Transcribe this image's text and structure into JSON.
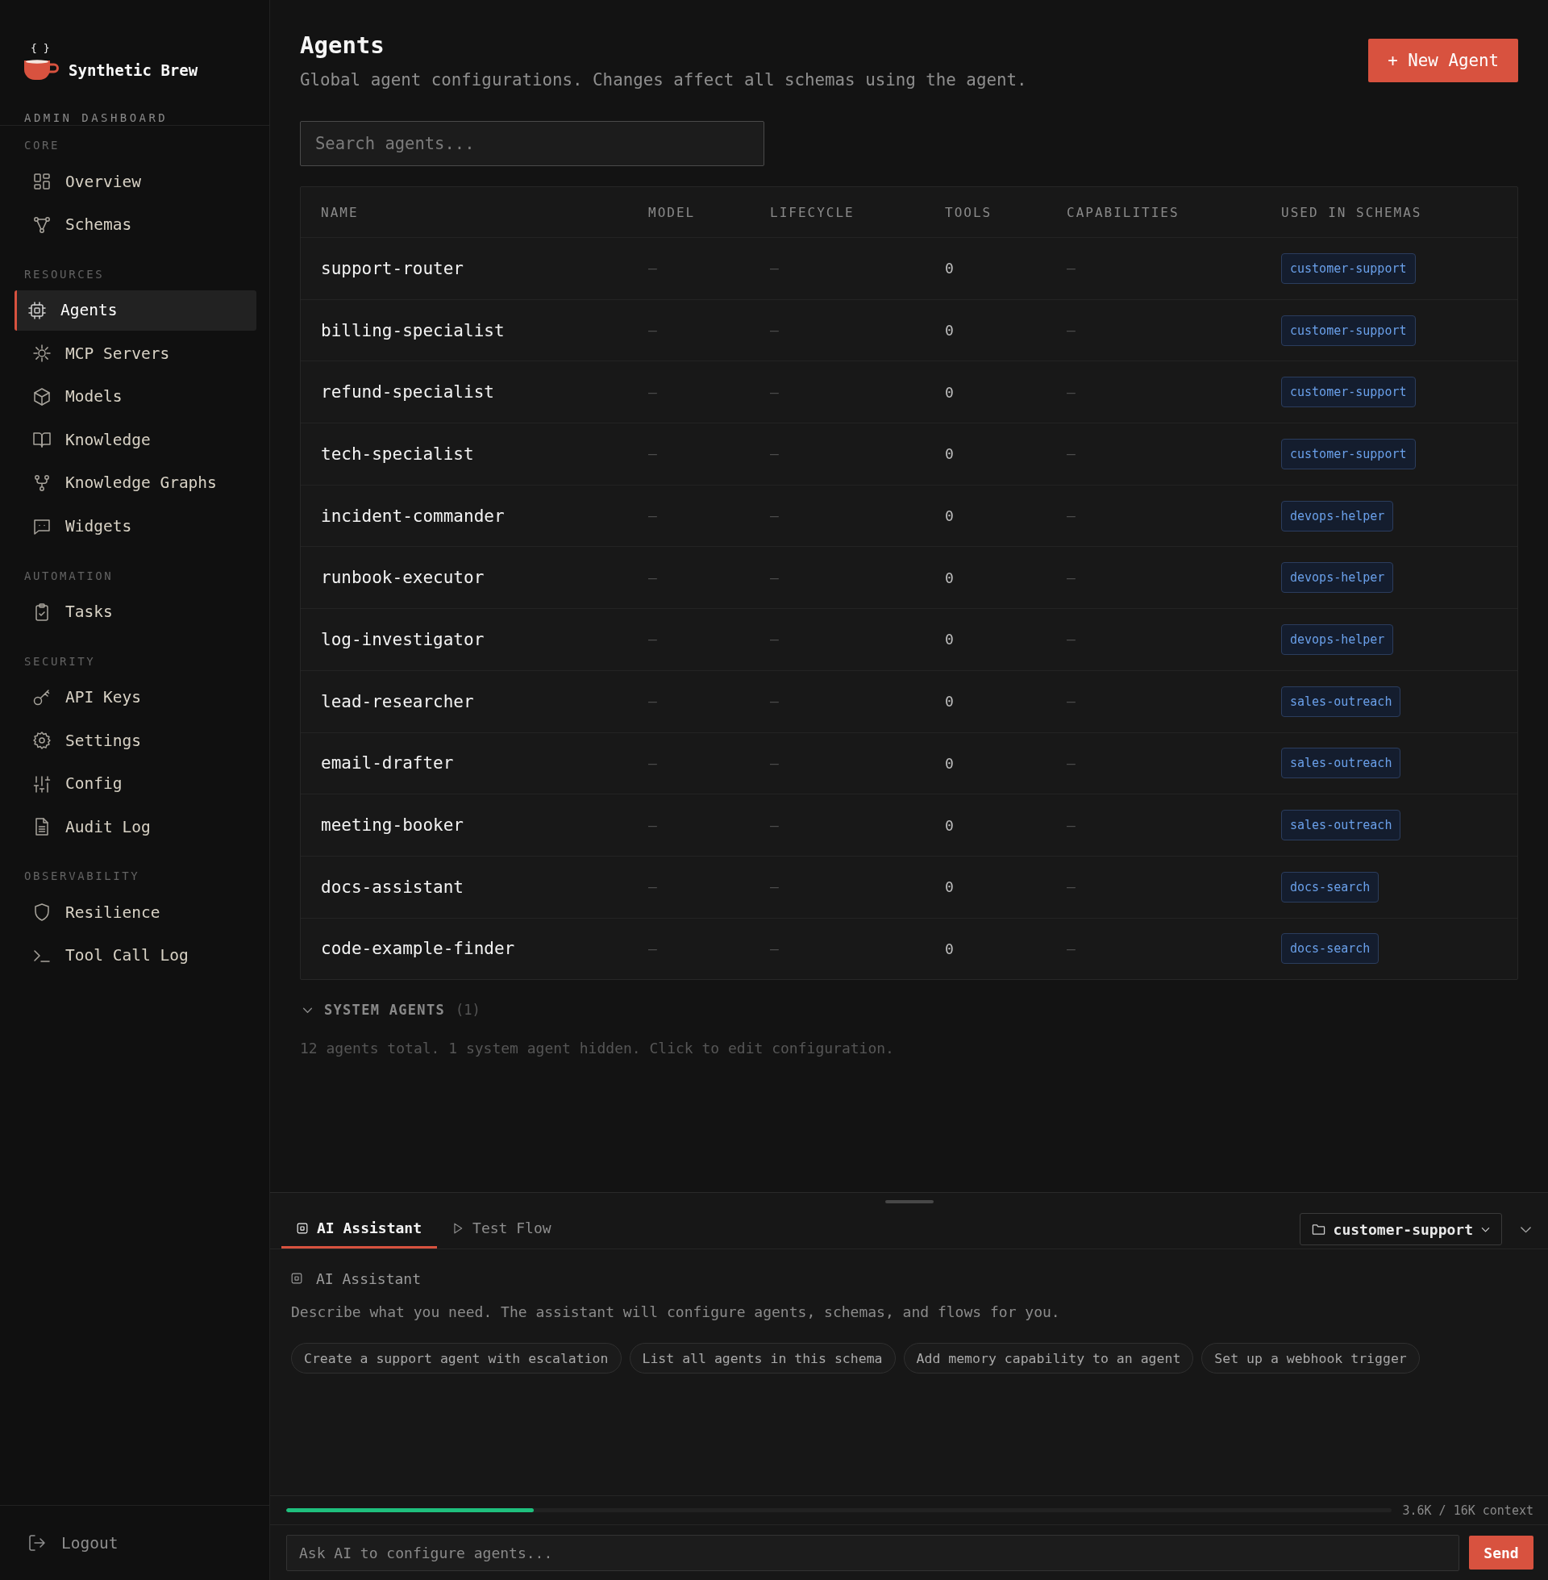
{
  "sidebar": {
    "brand": {
      "logo_mark": "{ }",
      "title": "Synthetic Brew",
      "subtitle": "ADMIN DASHBOARD"
    },
    "sections": [
      {
        "label": "CORE",
        "items": [
          {
            "label": "Overview",
            "selected": false
          },
          {
            "label": "Schemas",
            "selected": false
          }
        ]
      },
      {
        "label": "RESOURCES",
        "items": [
          {
            "label": "Agents",
            "selected": true
          },
          {
            "label": "MCP Servers",
            "selected": false
          },
          {
            "label": "Models",
            "selected": false
          },
          {
            "label": "Knowledge",
            "selected": false
          },
          {
            "label": "Knowledge Graphs",
            "selected": false
          },
          {
            "label": "Widgets",
            "selected": false
          }
        ]
      },
      {
        "label": "AUTOMATION",
        "items": [
          {
            "label": "Tasks",
            "selected": false
          }
        ]
      },
      {
        "label": "SECURITY",
        "items": [
          {
            "label": "API Keys",
            "selected": false
          },
          {
            "label": "Settings",
            "selected": false
          },
          {
            "label": "Config",
            "selected": false
          },
          {
            "label": "Audit Log",
            "selected": false
          }
        ]
      },
      {
        "label": "OBSERVABILITY",
        "items": [
          {
            "label": "Resilience",
            "selected": false
          },
          {
            "label": "Tool Call Log",
            "selected": false
          }
        ]
      }
    ],
    "logout": {
      "label": "Logout"
    }
  },
  "header": {
    "title": "Agents",
    "subtitle": "Global agent configurations. Changes affect all schemas using the agent.",
    "new_button": "+ New Agent"
  },
  "search": {
    "placeholder": "Search agents..."
  },
  "table": {
    "columns": [
      "NAME",
      "MODEL",
      "LIFECYCLE",
      "TOOLS",
      "CAPABILITIES",
      "USED IN SCHEMAS"
    ],
    "rows": [
      {
        "name": "support-router",
        "model": "—",
        "lifecycle": "—",
        "tools": "0",
        "capabilities": "—",
        "used_in_schemas": [
          "customer-support"
        ]
      },
      {
        "name": "billing-specialist",
        "model": "—",
        "lifecycle": "—",
        "tools": "0",
        "capabilities": "—",
        "used_in_schemas": [
          "customer-support"
        ]
      },
      {
        "name": "refund-specialist",
        "model": "—",
        "lifecycle": "—",
        "tools": "0",
        "capabilities": "—",
        "used_in_schemas": [
          "customer-support"
        ]
      },
      {
        "name": "tech-specialist",
        "model": "—",
        "lifecycle": "—",
        "tools": "0",
        "capabilities": "—",
        "used_in_schemas": [
          "customer-support"
        ]
      },
      {
        "name": "incident-commander",
        "model": "—",
        "lifecycle": "—",
        "tools": "0",
        "capabilities": "—",
        "used_in_schemas": [
          "devops-helper"
        ]
      },
      {
        "name": "runbook-executor",
        "model": "—",
        "lifecycle": "—",
        "tools": "0",
        "capabilities": "—",
        "used_in_schemas": [
          "devops-helper"
        ]
      },
      {
        "name": "log-investigator",
        "model": "—",
        "lifecycle": "—",
        "tools": "0",
        "capabilities": "—",
        "used_in_schemas": [
          "devops-helper"
        ]
      },
      {
        "name": "lead-researcher",
        "model": "—",
        "lifecycle": "—",
        "tools": "0",
        "capabilities": "—",
        "used_in_schemas": [
          "sales-outreach"
        ]
      },
      {
        "name": "email-drafter",
        "model": "—",
        "lifecycle": "—",
        "tools": "0",
        "capabilities": "—",
        "used_in_schemas": [
          "sales-outreach"
        ]
      },
      {
        "name": "meeting-booker",
        "model": "—",
        "lifecycle": "—",
        "tools": "0",
        "capabilities": "—",
        "used_in_schemas": [
          "sales-outreach"
        ]
      },
      {
        "name": "docs-assistant",
        "model": "—",
        "lifecycle": "—",
        "tools": "0",
        "capabilities": "—",
        "used_in_schemas": [
          "docs-search"
        ]
      },
      {
        "name": "code-example-finder",
        "model": "—",
        "lifecycle": "—",
        "tools": "0",
        "capabilities": "—",
        "used_in_schemas": [
          "docs-search"
        ]
      }
    ]
  },
  "system_agents": {
    "label": "SYSTEM AGENTS",
    "count": "(1)"
  },
  "summary": "12 agents total. 1 system agent hidden. Click to edit configuration.",
  "assistant_panel": {
    "tabs": [
      {
        "label": "AI Assistant",
        "selected": true
      },
      {
        "label": "Test Flow",
        "selected": false
      }
    ],
    "schema_select": {
      "value": "customer-support"
    },
    "heading": "AI Assistant",
    "description": "Describe what you need. The assistant will configure agents, schemas, and flows for you.",
    "suggestions": [
      "Create a support agent with escalation",
      "List all agents in this schema",
      "Add memory capability to an agent",
      "Set up a webhook trigger"
    ],
    "context": {
      "level": 0.224,
      "reading": "3.6K / 16K context"
    },
    "input": {
      "placeholder": "Ask AI to configure agents..."
    },
    "send_button": "Send"
  }
}
